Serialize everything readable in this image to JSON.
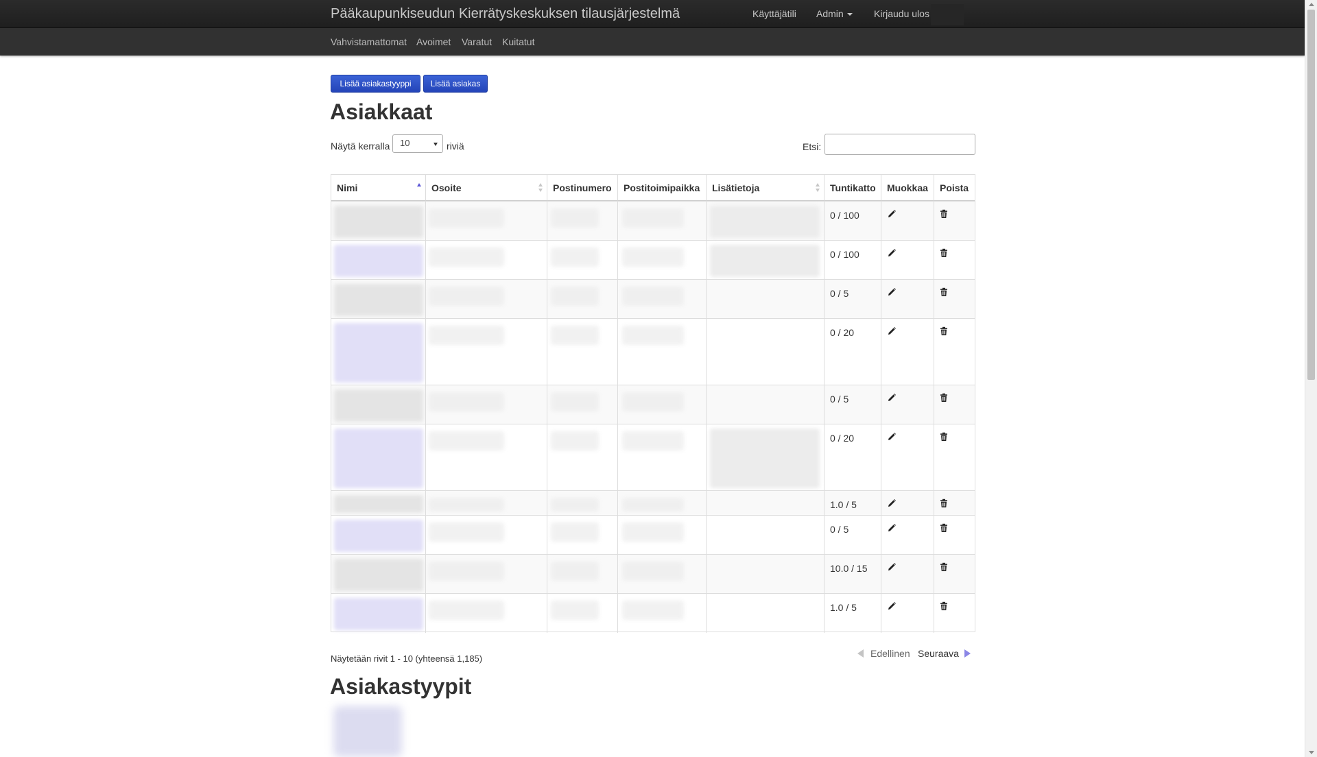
{
  "navbar": {
    "brand": "Pääkaupunkiseudun Kierrätyskeskuksen tilausjärjestelmä",
    "account": "Käyttäjätili",
    "admin": "Admin",
    "logout": "Kirjaudu ulos"
  },
  "subnav": [
    "Vahvistamattomat",
    "Avoimet",
    "Varatut",
    "Kuitatut"
  ],
  "buttons": {
    "add_customer_type": "Lisää asiakastyyppi",
    "add_customer": "Lisää asiakas"
  },
  "customers": {
    "title": "Asiakkaat",
    "show_prefix": "Näytä kerralla",
    "page_size": "10",
    "show_suffix": "riviä",
    "search_label": "Etsi:",
    "columns": [
      "Nimi",
      "Osoite",
      "Postinumero",
      "Postitoimipaikka",
      "Lisätietoja",
      "Tuntikatto",
      "Muokkaa",
      "Poista"
    ],
    "rows": [
      {
        "tuntikatto": "0 / 100"
      },
      {
        "tuntikatto": "0 / 100"
      },
      {
        "tuntikatto": "0 / 5"
      },
      {
        "tuntikatto": "0 / 20"
      },
      {
        "tuntikatto": "0 / 5"
      },
      {
        "tuntikatto": "0 / 20"
      },
      {
        "tuntikatto": "1.0 / 5"
      },
      {
        "tuntikatto": "0 / 5"
      },
      {
        "tuntikatto": "10.0 / 15"
      },
      {
        "tuntikatto": "1.0 / 5"
      }
    ],
    "info": "Näytetään rivit 1 - 10 (yhteensä 1,185)",
    "prev": "Edellinen",
    "next": "Seuraava"
  },
  "customer_types": {
    "title": "Asiakastyypit"
  },
  "icons": {
    "edit": "pencil-icon",
    "delete": "trash-icon",
    "sort": "sort-icon"
  },
  "colors": {
    "navbar": "#222222",
    "button": "#2f52c8",
    "sort_active": "#5b56d6"
  }
}
